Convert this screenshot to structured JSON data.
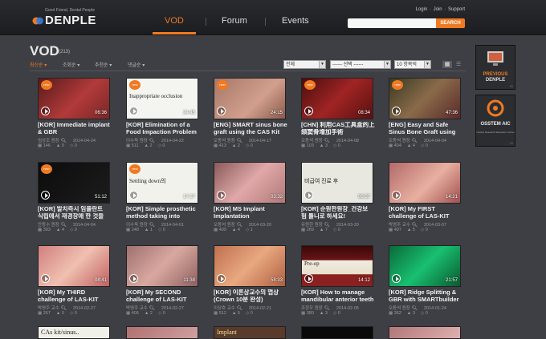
{
  "header": {
    "logo_tagline": "Good Friend, Dental People",
    "logo_name": "DENPLE",
    "nav": [
      "VOD",
      "Forum",
      "Events"
    ],
    "links": [
      "Login",
      "Join",
      "Support"
    ],
    "search_placeholder": "",
    "search_button": "SEARCH"
  },
  "main": {
    "title": "VOD",
    "count": "(213)",
    "sort_options": [
      "최신순",
      "조회순",
      "추천순",
      "댓글순"
    ],
    "filters": [
      "전체",
      "------ 선택 ------",
      "10 항목씩"
    ]
  },
  "videos": [
    {
      "title1": "[KOR] Immediate implant",
      "title2": "& GBR",
      "duration": "06:36",
      "author": "임상조 원장",
      "date": "2014-04-24",
      "views": "146",
      "likes": "0",
      "comments": "0",
      "new": true,
      "bg": "linear-gradient(135deg,#5a1a1a,#b23a3a 55%,#7a2626)"
    },
    {
      "title1": "[KOR] Elimination of a",
      "title2": "Food Impaction Problem",
      "duration": "24:45",
      "author": "이수욱 원장",
      "date": "2014-04-22",
      "views": "511",
      "likes": "2",
      "comments": "0",
      "new": true,
      "bg": "#f4f4f0",
      "text": "Inappropriate occlusion"
    },
    {
      "title1": "[ENG] SMART sinus bone",
      "title2": "graft using the CAS Kit",
      "duration": "24:15",
      "author": "오동석 원장",
      "date": "2014-04-17",
      "views": "413",
      "likes": "2",
      "comments": "0",
      "new": true,
      "bg": "linear-gradient(135deg,#a77868,#d29f8d 60%,#8a5a4a)"
    },
    {
      "title1": "[CHN] 利用CAS工具盒的上",
      "title2": "颌窦骨增加手術",
      "duration": "08:34",
      "author": "오동석 원장",
      "date": "2014-04-08",
      "views": "103",
      "likes": "3",
      "comments": "0",
      "new": true,
      "bg": "linear-gradient(135deg,#4a0e0e,#a02424 50%,#5a1010)"
    },
    {
      "title1": "[ENG] Easy and Safe",
      "title2": "Sinus Bone Graft using",
      "duration": "47:36",
      "author": "오동석 원장",
      "date": "2014-04-04",
      "views": "404",
      "likes": "4",
      "comments": "0",
      "new": true,
      "bg": "linear-gradient(135deg,#3a3a22,#8a6a4a 50%,#5a2a2a)"
    },
    {
      "title1": "[KOR] 발치즉시 임플란트",
      "title2": "식립에서 재경장애 한 것들",
      "duration": "51:12",
      "author": "안동수 원장",
      "date": "2014-04-04",
      "views": "393",
      "likes": "4",
      "comments": "0",
      "new": true,
      "bg": "linear-gradient(135deg,#0c0c0c,#1c1c1c)"
    },
    {
      "title1": "[KOR] Simple prosthetic",
      "title2": "method taking into",
      "duration": "17:27",
      "author": "이수욱 원장",
      "date": "2014-04-01",
      "views": "248",
      "likes": "1",
      "comments": "0",
      "new": true,
      "bg": "#f2f2ec",
      "text": "Settling down의"
    },
    {
      "title1": "[KOR] MS Implant",
      "title2": "Implantation",
      "duration": "03:32",
      "author": "오동석 원장",
      "date": "2014-03-20",
      "views": "409",
      "likes": "4",
      "comments": "1",
      "new": false,
      "bg": "linear-gradient(135deg,#8a5a5a,#e0a8a8 50%,#b27878)"
    },
    {
      "title1": "[KOR] 순원한원장_건강보",
      "title2": "험 틀니로 하세요!",
      "duration": "86:57",
      "author": "유원한 원장",
      "date": "2014-03-20",
      "views": "269",
      "likes": "7",
      "comments": "0",
      "new": false,
      "bg": "#e8e8e0",
      "text": "비급여 진료 후"
    },
    {
      "title1": "[KOR] My FIRST",
      "title2": "challenge of LAS-KIT",
      "duration": "14:21",
      "author": "박영주 교수",
      "date": "2014-03-07",
      "views": "497",
      "likes": "5",
      "comments": "0",
      "new": false,
      "bg": "linear-gradient(135deg,#b26a6a,#e8b0a0 55%,#a05050)"
    },
    {
      "title1": "[KOR] My THIRD",
      "title2": "challenge of LAS-KIT",
      "duration": "08:41",
      "author": "박영주 교수",
      "date": "2014-02-27",
      "views": "267",
      "likes": "0",
      "comments": "0",
      "new": false,
      "bg": "linear-gradient(135deg,#d08080,#f0c0b0 50%,#c06060)"
    },
    {
      "title1": "[KOR] My SECOND",
      "title2": "challenge of LAS-KIT",
      "duration": "11:38",
      "author": "박영주 교수",
      "date": "2014-02-27",
      "views": "406",
      "likes": "2",
      "comments": "0",
      "new": false,
      "bg": "linear-gradient(135deg,#a07070,#d8a8a0 50%,#906060)"
    },
    {
      "title1": "[KOR] 이론상교수의 맵상",
      "title2": "(Crown 10분 완성)",
      "duration": "58:33",
      "author": "이상호 교수",
      "date": "2014-02-21",
      "views": "512",
      "likes": "5",
      "comments": "0",
      "new": false,
      "bg": "linear-gradient(135deg,#c07050,#e8a880 50%,#b06040)"
    },
    {
      "title1": "[KOR] How to manage",
      "title2": "mandibular anterior teeth",
      "duration": "14:12",
      "author": "조정우 원장",
      "date": "2014-02-05",
      "views": "380",
      "likes": "3",
      "comments": "0",
      "new": false,
      "bg": "linear-gradient(180deg,#3a0808 0%,#6a1414 35%,#f0ece0 36%,#e8e0cc 70%,#8a2020 71%)",
      "text": "Pre-op"
    },
    {
      "title1": "[KOR] Ridge Splitting &",
      "title2": "GBR with SMARTbuilder",
      "duration": "21:57",
      "author": "오동석 원장",
      "date": "2014-01-24",
      "views": "362",
      "likes": "3",
      "comments": "0",
      "new": false,
      "bg": "linear-gradient(135deg,#0a6a3a,#18c070 50%,#0a5a30)"
    }
  ],
  "bottom_row": [
    {
      "bg": "#f0f0e8",
      "text": "CAs kit/sinus.."
    },
    {
      "bg": "linear-gradient(135deg,#b07070,#d0a0a0)",
      "text": ""
    },
    {
      "bg": "#5a3a2a",
      "text": "Implant"
    },
    {
      "bg": "#0a0a0a",
      "text": ""
    },
    {
      "bg": "linear-gradient(135deg,#b07878,#e0b0b0)",
      "text": ""
    }
  ],
  "sidebar": [
    {
      "label1": "PREVIOUS",
      "label2": "DENPLE",
      "sub": ""
    },
    {
      "label1": "OSSTEM AIC",
      "label2": "",
      "sub": "Implant Research Education Center"
    }
  ],
  "colors": {
    "accent": "#f07a22",
    "background": "#3d3f44",
    "header": "#1e1f22"
  }
}
